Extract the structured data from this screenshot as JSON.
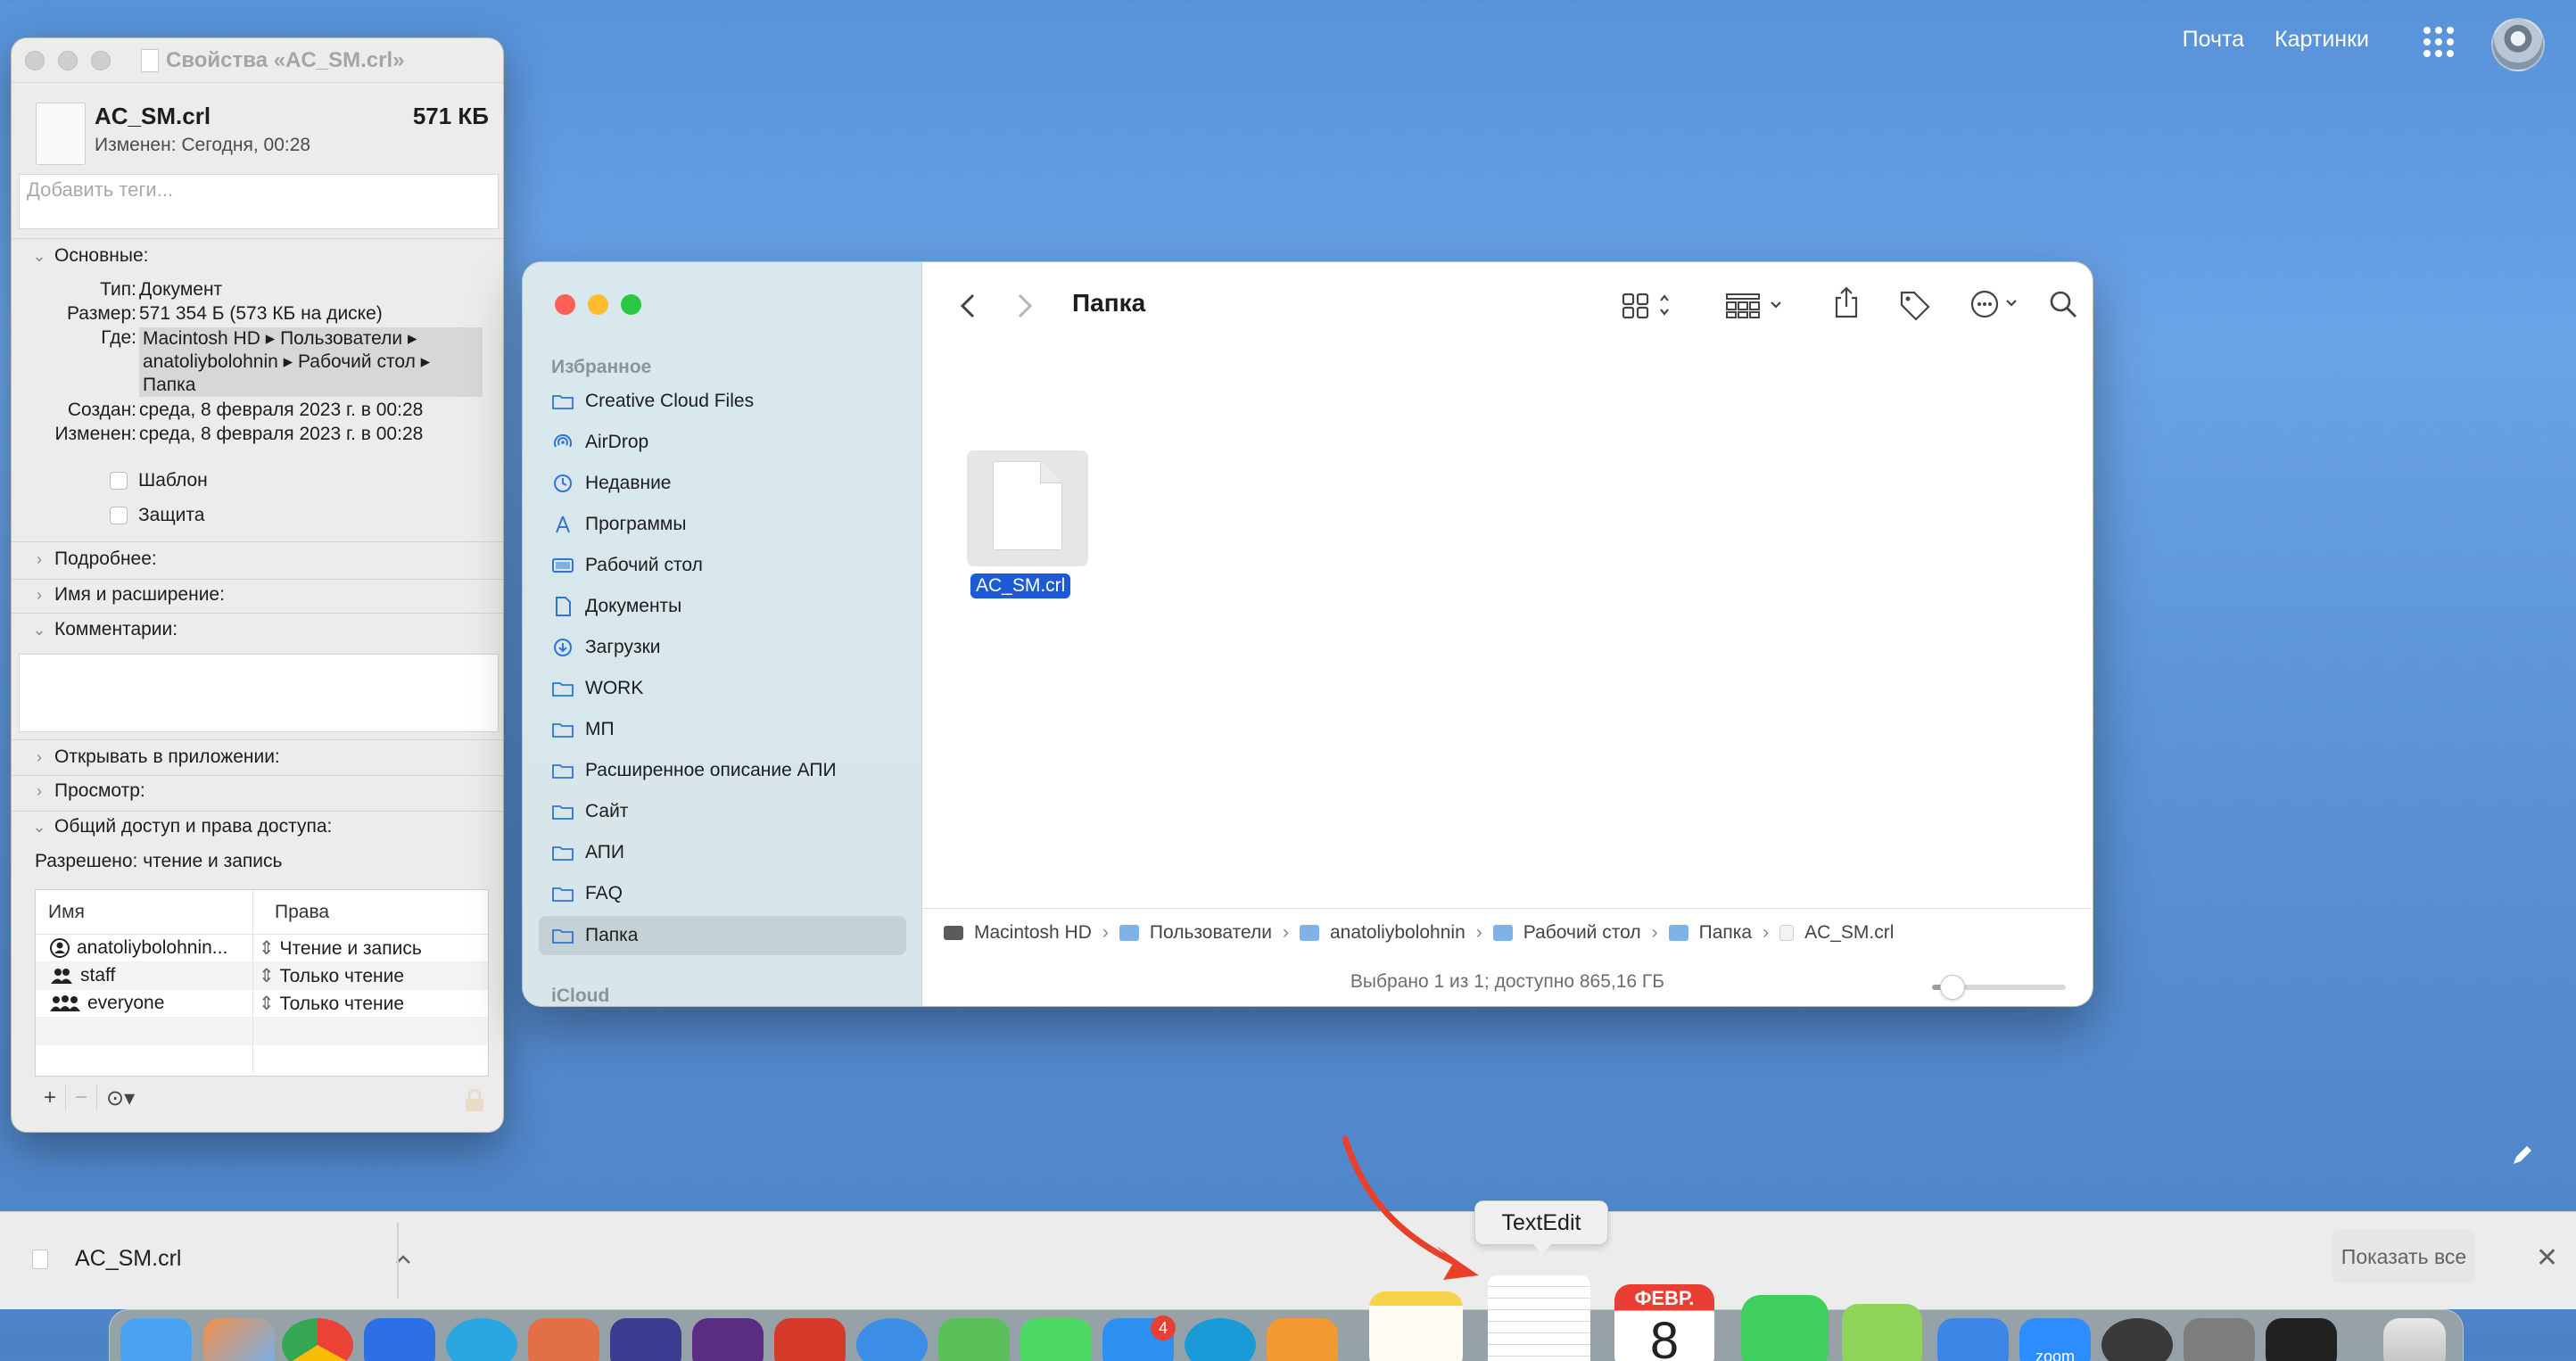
{
  "top_links": {
    "mail": "Почта",
    "images": "Картинки"
  },
  "info_window": {
    "title": "Свойства «AC_SM.crl»",
    "file_name": "AC_SM.crl",
    "file_size": "571 КБ",
    "modified_short": "Изменен: Сегодня, 00:28",
    "tags_placeholder": "Добавить теги...",
    "general_section": "Основные:",
    "kind_key": "Тип:",
    "kind_val": "Документ",
    "size_key": "Размер:",
    "size_val": "571 354 Б (573 КБ на диске)",
    "where_key": "Где:",
    "where_line1": "Macintosh HD ▸ Пользователи ▸",
    "where_line2": "anatoliybolohnin ▸ Рабочий стол ▸",
    "where_line3": "Папка",
    "created_key": "Создан:",
    "created_val": "среда, 8 февраля 2023 г. в 00:28",
    "modified_key": "Изменен:",
    "modified_val": "среда, 8 февраля 2023 г. в 00:28",
    "template_label": "Шаблон",
    "locked_label": "Защита",
    "more_info": "Подробнее:",
    "name_ext": "Имя и расширение:",
    "comments": "Комментарии:",
    "open_with": "Открывать в приложении:",
    "preview": "Просмотр:",
    "sharing": "Общий доступ и права доступа:",
    "allowed": "Разрешено: чтение и запись",
    "perm_col_name": "Имя",
    "perm_col_priv": "Права",
    "perms": [
      {
        "name": "anatoliybolohnin...",
        "priv": "Чтение и запись"
      },
      {
        "name": "staff",
        "priv": "Только чтение"
      },
      {
        "name": "everyone",
        "priv": "Только чтение"
      }
    ]
  },
  "finder": {
    "title": "Папка",
    "favorites_header": "Избранное",
    "icloud_header": "iCloud",
    "sidebar": [
      {
        "label": "Creative Cloud Files",
        "icon": "folder-icon"
      },
      {
        "label": "AirDrop",
        "icon": "airdrop-icon"
      },
      {
        "label": "Недавние",
        "icon": "clock-icon"
      },
      {
        "label": "Программы",
        "icon": "applications-icon"
      },
      {
        "label": "Рабочий стол",
        "icon": "desktop-icon"
      },
      {
        "label": "Документы",
        "icon": "document-icon"
      },
      {
        "label": "Загрузки",
        "icon": "download-icon"
      },
      {
        "label": "WORK",
        "icon": "folder-icon"
      },
      {
        "label": "МП",
        "icon": "folder-icon"
      },
      {
        "label": "Расширенное описание АПИ",
        "icon": "folder-icon"
      },
      {
        "label": "Сайт",
        "icon": "folder-icon"
      },
      {
        "label": "АПИ",
        "icon": "folder-icon"
      },
      {
        "label": "FAQ",
        "icon": "folder-icon"
      },
      {
        "label": "Папка",
        "icon": "folder-icon"
      }
    ],
    "selected_file": "AC_SM.crl",
    "path": [
      "Macintosh HD",
      "Пользователи",
      "anatoliybolohnin",
      "Рабочий стол",
      "Папка",
      "AC_SM.crl"
    ],
    "status": "Выбрано 1 из 1; доступно 865,16 ГБ",
    "icon_size_slider": 0.15
  },
  "download_bar": {
    "file": "AC_SM.crl",
    "show_all": "Показать все"
  },
  "dock": {
    "tooltip": "TextEdit",
    "calendar_month": "ФЕВР.",
    "calendar_day": "8",
    "appstore_badge": "4",
    "zoom_label": "zoom"
  },
  "colors": {
    "selection": "#1d5bd6",
    "annotation_arrow": "#e8402a",
    "desktop": "#5892d9"
  }
}
